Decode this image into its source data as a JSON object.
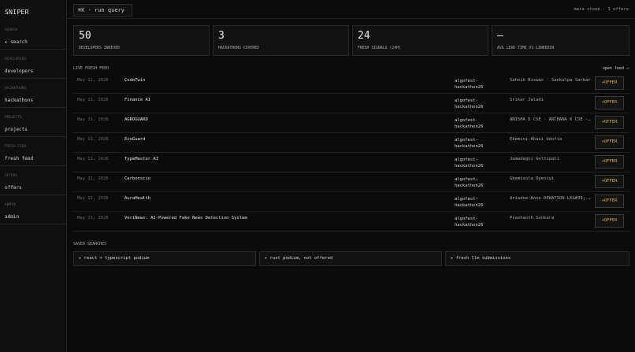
{
  "brand": "SNIPER",
  "nav": [
    {
      "section": "SEARCH",
      "label": "▸ search"
    },
    {
      "section": "DEVELOPERS",
      "label": "developers"
    },
    {
      "section": "HACKATHONS",
      "label": "hackathons"
    },
    {
      "section": "PROJECTS",
      "label": "projects"
    },
    {
      "section": "FRESH FEED",
      "label": "fresh feed"
    },
    {
      "section": "OFFERS",
      "label": "offers"
    },
    {
      "section": "ADMIN",
      "label": "admin"
    }
  ],
  "topbar": {
    "command": "⌘K · run query",
    "user": "mara stone · 1 offers"
  },
  "stats": [
    {
      "value": "50",
      "label": "DEVELOPERS INDEXED"
    },
    {
      "value": "3",
      "label": "HACKATHONS COVERED"
    },
    {
      "value": "24",
      "label": "FRESH SIGNALS (24H)"
    },
    {
      "value": "—",
      "label": "AVG LEAD TIME VS LINKEDIN"
    }
  ],
  "feed": {
    "title": "LIVE FRESH FEED",
    "open_label": "open feed →",
    "offer_label": "+OFFER",
    "rows": [
      {
        "date": "May 11, 2026",
        "title": "CodeTwin",
        "event": "algofest-hackathon26",
        "people": "Sahnik Biswas · Sankalpa Sarkar"
      },
      {
        "date": "May 11, 2026",
        "title": "Finance AI",
        "event": "algofest-hackathon26",
        "people": "Srikar Jaladi"
      },
      {
        "date": "May 11, 2026",
        "title": "AGROGUARD",
        "event": "algofest-hackathon26",
        "people": "ANISHA D CSE · ARCHANA K CSE · ..."
      },
      {
        "date": "May 11, 2026",
        "title": "EcoGuard",
        "event": "algofest-hackathon26",
        "people": "Ekemini-Abasi Udofia"
      },
      {
        "date": "May 11, 2026",
        "title": "TypeMaster AI",
        "event": "algofest-hackathon26",
        "people": "Jamadagni Gottipati"
      },
      {
        "date": "May 11, 2026",
        "title": "Carbonscio",
        "event": "algofest-hackathon26",
        "people": "Gbemisola Oyeniyi"
      },
      {
        "date": "May 11, 2026",
        "title": "AuraHealth",
        "event": "algofest-hackathon26",
        "people": "Ariadne-Anne DEWATSON-LE&#39;..."
      },
      {
        "date": "May 11, 2026",
        "title": "VeriNews: AI-Powered Fake News Detection System",
        "event": "algofest-hackathon26",
        "people": "Prashanth Sunkara"
      }
    ]
  },
  "saved": {
    "title": "SAVED SEARCHES",
    "items": [
      "▸ react + typescript podium",
      "▸ rust podium, not offered",
      "▸ fresh llm submissions"
    ]
  },
  "colors": {
    "accent": "#e3a24a",
    "background": "#0b0b0b"
  }
}
